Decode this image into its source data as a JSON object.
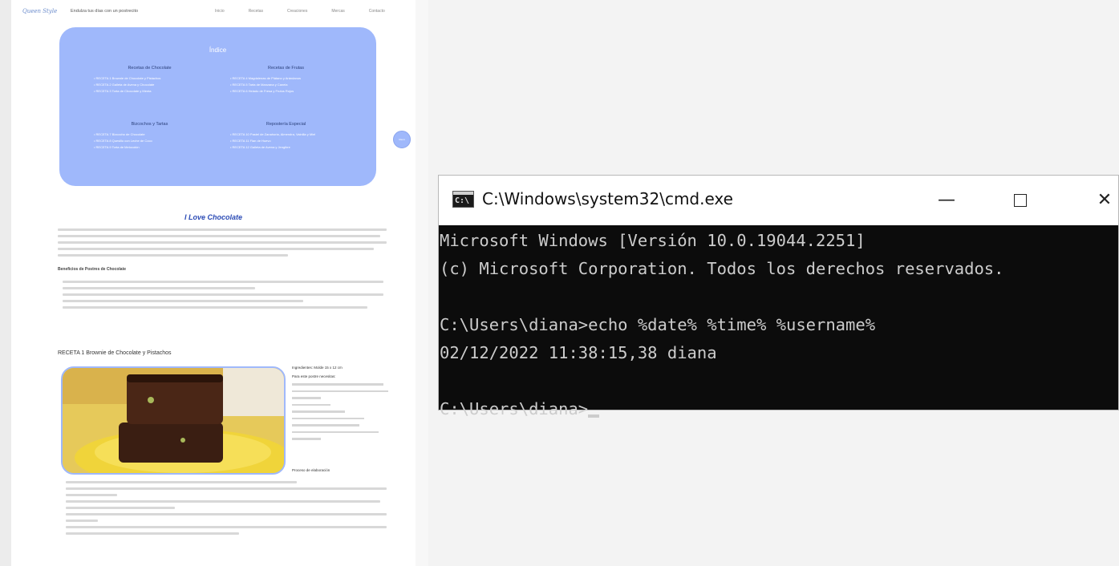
{
  "browser_page": {
    "logo": "Queen Style",
    "tagline": "Endulza tus días con un postrecito",
    "nav": [
      "Inicio",
      "Recetas",
      "Creaciones",
      "Mercas",
      "Contacto"
    ],
    "index": {
      "title": "Índice",
      "sections": [
        {
          "heading": "Recetas de Chocolate",
          "items": [
            "RECETA 1 Brownie de Chocolate y Pistachos",
            "RECETA 2 Galleta de Avena y Chocolate",
            "RECETA 3 Torta de Chocolate y Menta"
          ]
        },
        {
          "heading": "Recetas de Frutas",
          "items": [
            "RECETA 4 Magdalenas de Plátano y Arándanos",
            "RECETA 5 Tarta de Manzana y Canela",
            "RECETA 6 Helado de Fresa y Frutos Rojos"
          ]
        },
        {
          "heading": "Bizcochos y Tartas",
          "items": [
            "RECETA 7 Bizcocho de Chocolate",
            "RECETA 8 Quesillo con Leche de Coco",
            "RECETA 9 Torta de Melocotón"
          ]
        },
        {
          "heading": "Repostería Especial",
          "items": [
            "RECETA 10 Pastel de Zanahoria, Almendra, Vainilla y Miel",
            "RECETA 11 Flan de Huevo",
            "RECETA 12 Galleta de Avena y Jengibre"
          ]
        }
      ]
    },
    "side_button": "Menú",
    "love_heading": "I Love Chocolate",
    "subheading": "Beneficios de Postres de Chocolate",
    "recipe_title": "RECETA 1 Brownie de Chocolate y Pistachos",
    "ingredients_heading": "Ingredientes: Molde 15 x 12 cm",
    "ingredients_subheading": "Para este postre necesitas:",
    "process_heading": "Proceso de elaboración"
  },
  "cmd": {
    "title": "C:\\Windows\\system32\\cmd.exe",
    "lines": [
      "Microsoft Windows [Versión 10.0.19044.2251]",
      "(c) Microsoft Corporation. Todos los derechos reservados.",
      "",
      "C:\\Users\\diana>echo %date% %time% %username%",
      "02/12/2022 11:38:15,38 diana",
      "",
      "C:\\Users\\diana>"
    ],
    "buttons": {
      "minimize": "—",
      "close": "✕"
    }
  }
}
